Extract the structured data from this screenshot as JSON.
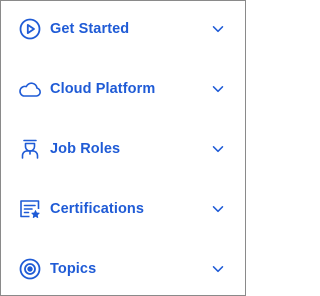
{
  "accent_color": "#1f5bd6",
  "menu": {
    "items": [
      {
        "label": "Get Started",
        "icon": "play-circle-icon",
        "expanded": false
      },
      {
        "label": "Cloud Platform",
        "icon": "cloud-icon",
        "expanded": false
      },
      {
        "label": "Job Roles",
        "icon": "person-role-icon",
        "expanded": false
      },
      {
        "label": "Certifications",
        "icon": "certificate-icon",
        "expanded": false
      },
      {
        "label": "Topics",
        "icon": "target-icon",
        "expanded": false
      }
    ]
  }
}
